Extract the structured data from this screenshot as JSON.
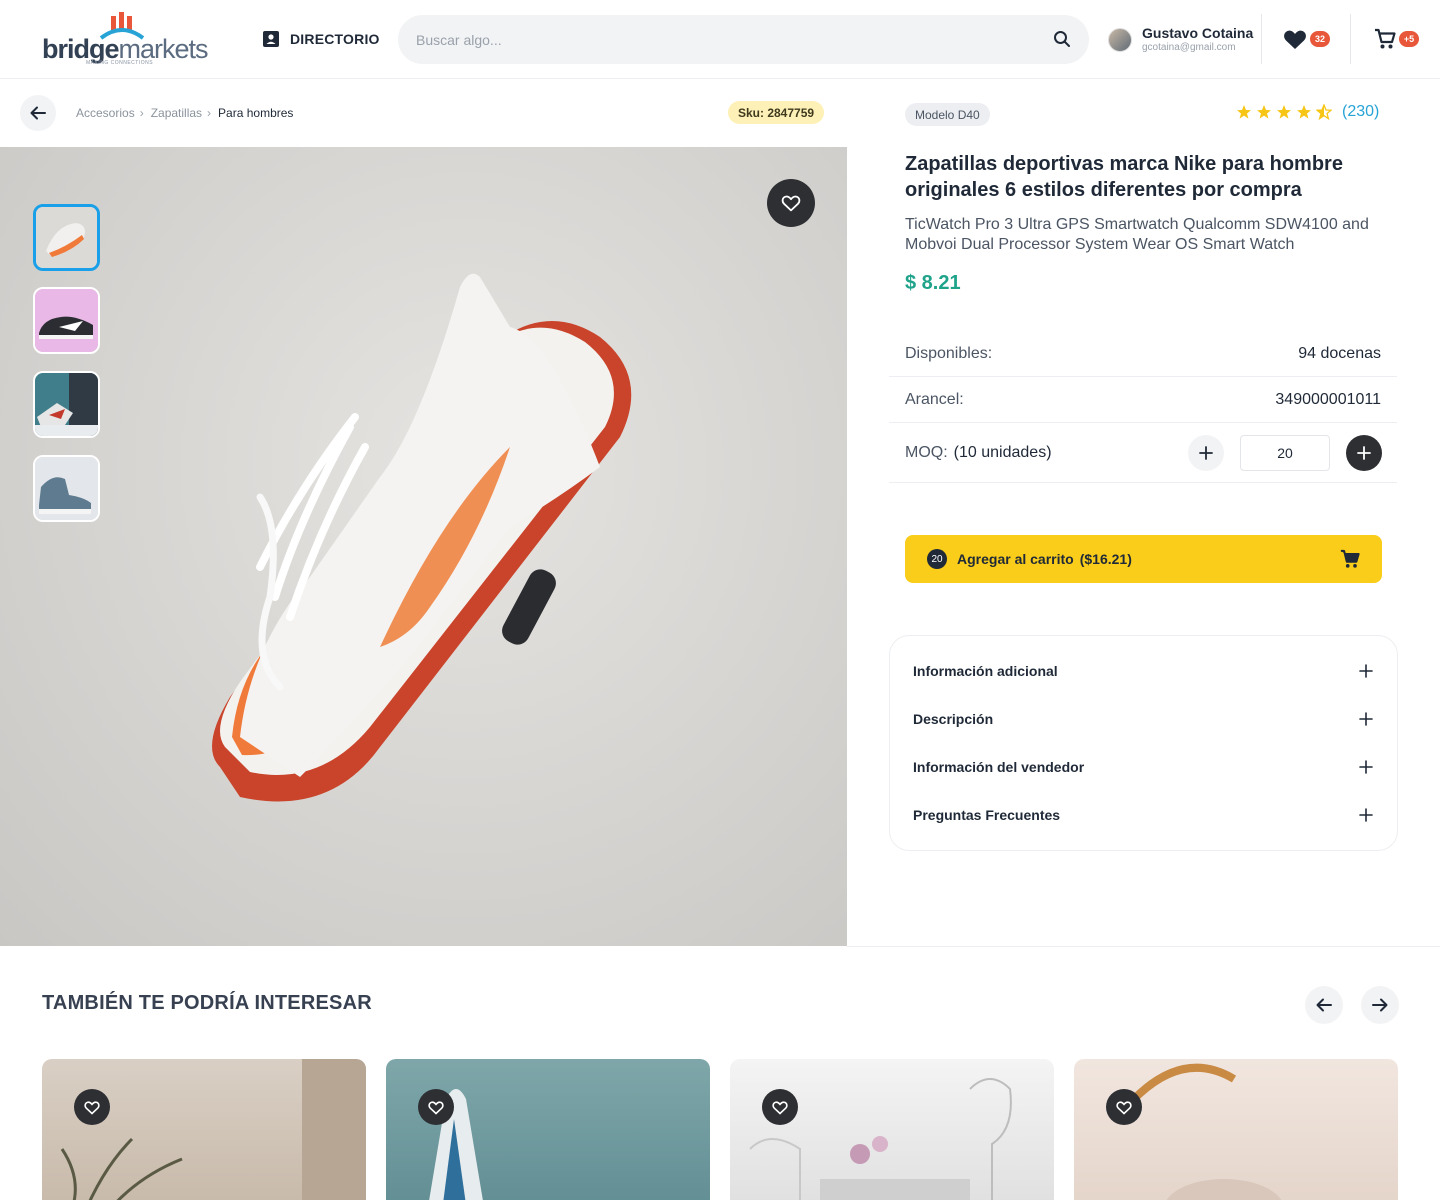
{
  "header": {
    "logo": {
      "word_bold": "bridge",
      "word_light": "markets",
      "tagline": "MAKING CONNECTIONS"
    },
    "directory_label": "DIRECTORIO",
    "search": {
      "placeholder": "Buscar algo...",
      "value": ""
    },
    "user": {
      "name": "Gustavo Cotaina",
      "email": "gcotaina@gmail.com"
    },
    "favorites_count": "32",
    "cart_count": "+5",
    "accent_badge_color": "#e8573a"
  },
  "breadcrumb": {
    "items": [
      "Accesorios",
      "Zapatillas",
      "Para hombres"
    ],
    "separator": "›",
    "sku": "Sku: 2847759"
  },
  "gallery": {
    "thumbnails": [
      "sneaker-white-orange",
      "sneaker-black-white",
      "sneakers-worn",
      "sneaker-grey-high"
    ],
    "selected_index": 0
  },
  "product": {
    "model": "Modelo D40",
    "rating": 4.5,
    "rating_count": "(230)",
    "title": "Zapatillas deportivas marca Nike para hombre originales 6 estilos diferentes por compra",
    "subtitle": "TicWatch Pro 3 Ultra GPS Smartwatch Qualcomm SDW4100 and Mobvoi Dual Processor System Wear OS Smart Watch",
    "price": "$ 8.21",
    "price_color": "#1fa38a",
    "available_label": "Disponibles:",
    "available_value": "94 docenas",
    "tariff_label": "Arancel:",
    "tariff_value": "349000001011",
    "moq_label": "MOQ:",
    "moq_value": "(10 unidades)",
    "quantity": "20"
  },
  "add_to_cart": {
    "qty_badge": "20",
    "label": "Agregar al carrito",
    "amount": "($16.21)",
    "color": "#f9cd19"
  },
  "accordion": {
    "items": [
      "Información adicional",
      "Descripción",
      "Información del vendedor",
      "Preguntas Frecuentes"
    ]
  },
  "related": {
    "title": "TAMBIÉN TE PODRÍA INTERESAR"
  }
}
